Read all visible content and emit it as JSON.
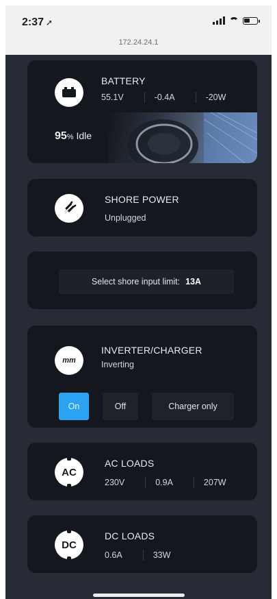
{
  "status_bar": {
    "time": "2:37",
    "url": "172.24.24.1"
  },
  "battery": {
    "title": "BATTERY",
    "voltage": "55.1V",
    "current": "-0.4A",
    "power": "-20W",
    "soc_value": "95",
    "soc_unit": "%",
    "state": "Idle"
  },
  "shore_power": {
    "title": "SHORE POWER",
    "status": "Unplugged"
  },
  "shore_limit": {
    "label": "Select shore input limit:",
    "value": "13A"
  },
  "inverter": {
    "title": "INVERTER/CHARGER",
    "status": "Inverting",
    "icon_text": "mm",
    "buttons": {
      "on": "On",
      "off": "Off",
      "charger_only": "Charger only"
    },
    "active_mode": "On",
    "accent": "#2aa3f3"
  },
  "ac_loads": {
    "title": "AC LOADS",
    "icon_text": "AC",
    "voltage": "230V",
    "current": "0.9A",
    "power": "207W"
  },
  "dc_loads": {
    "title": "DC LOADS",
    "icon_text": "DC",
    "current": "0.6A",
    "power": "33W"
  }
}
